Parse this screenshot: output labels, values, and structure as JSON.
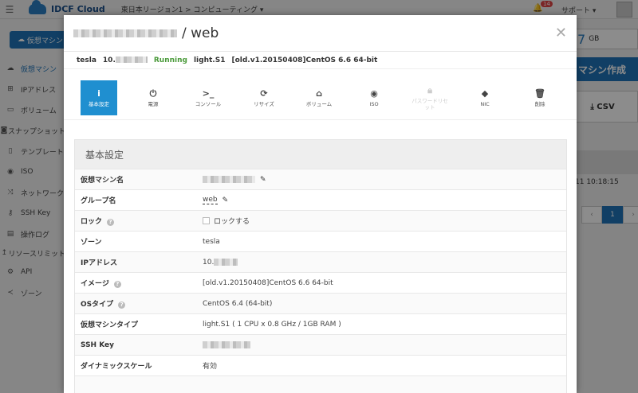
{
  "topbar": {
    "brand": "IDCF Cloud",
    "breadcrumb": "東日本リージョン1 > コンピューティング ▾",
    "notification_count": "14",
    "support_label": "サポート ▾"
  },
  "sidebar": {
    "create_button": "仮想マシン",
    "items": [
      {
        "label": "仮想マシン",
        "icon": "cloud-icon"
      },
      {
        "label": "IPアドレス",
        "icon": "network-icon"
      },
      {
        "label": "ボリューム",
        "icon": "drive-icon"
      },
      {
        "label": "スナップショット",
        "icon": "camera-icon"
      },
      {
        "label": "テンプレート",
        "icon": "file-icon"
      },
      {
        "label": "ISO",
        "icon": "disc-icon"
      },
      {
        "label": "ネットワーク",
        "icon": "shuffle-icon"
      },
      {
        "label": "SSH Key",
        "icon": "key-icon"
      },
      {
        "label": "操作ログ",
        "icon": "log-icon"
      },
      {
        "label": "リソースリミット",
        "icon": "limit-icon"
      },
      {
        "label": "API",
        "icon": "gears-icon"
      },
      {
        "label": "ゾーン",
        "icon": "share-icon"
      }
    ]
  },
  "right_panel": {
    "storage_value": "7",
    "storage_unit": "GB",
    "create_vm_button": "マシン作成",
    "csv_button": "CSV",
    "timestamp": "11 10:18:15",
    "pager_prev": "‹",
    "pager_current": "1",
    "pager_next": "›"
  },
  "modal": {
    "title_suffix": "/ web",
    "info": {
      "zone": "tesla",
      "ip_prefix": "10.",
      "status": "Running",
      "plan": "light.S1",
      "image": "[old.v1.20150408]CentOS 6.6 64-bit"
    },
    "actions": [
      {
        "label": "基本設定",
        "icon": "info-icon",
        "state": "active"
      },
      {
        "label": "電源",
        "icon": "power-icon",
        "state": "normal"
      },
      {
        "label": "コンソール",
        "icon": "terminal-icon",
        "state": "normal"
      },
      {
        "label": "リサイズ",
        "icon": "refresh-icon",
        "state": "normal"
      },
      {
        "label": "ボリューム",
        "icon": "drive-icon",
        "state": "normal"
      },
      {
        "label": "ISO",
        "icon": "disc-icon",
        "state": "normal"
      },
      {
        "label": "パスワードリセット",
        "icon": "lock-icon",
        "state": "disabled"
      },
      {
        "label": "NIC",
        "icon": "tag-icon",
        "state": "normal"
      },
      {
        "label": "削除",
        "icon": "trash-icon",
        "state": "normal"
      }
    ],
    "section_title": "基本設定",
    "rows": [
      {
        "key": "仮想マシン名",
        "value": ""
      },
      {
        "key": "グループ名",
        "value": "web"
      },
      {
        "key": "ロック",
        "value": "ロックする"
      },
      {
        "key": "ゾーン",
        "value": "tesla"
      },
      {
        "key": "IPアドレス",
        "value": "10."
      },
      {
        "key": "イメージ",
        "value": "[old.v1.20150408]CentOS 6.6 64-bit"
      },
      {
        "key": "OSタイプ",
        "value": "CentOS 6.4 (64-bit)"
      },
      {
        "key": "仮想マシンタイプ",
        "value": "light.S1 ( 1 CPU x 0.8 GHz / 1GB RAM )"
      },
      {
        "key": "SSH Key",
        "value": ""
      },
      {
        "key": "ダイナミックスケール",
        "value": "有効"
      },
      {
        "key": "",
        "value": ""
      }
    ],
    "colors": {
      "accent": "#1f8fd0",
      "running": "#4a9a3a",
      "brand": "#1f74b8"
    }
  }
}
